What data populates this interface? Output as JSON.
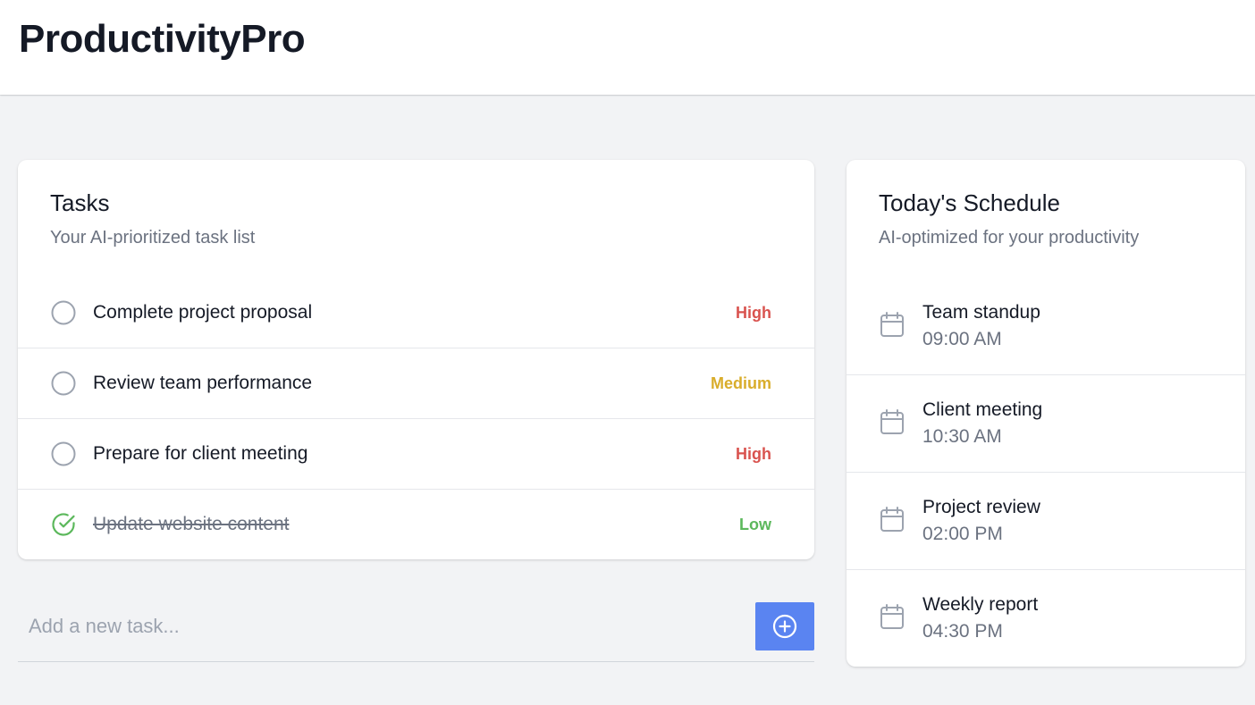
{
  "app": {
    "title": "ProductivityPro"
  },
  "tasks": {
    "title": "Tasks",
    "subtitle": "Your AI-prioritized task list",
    "items": [
      {
        "label": "Complete project proposal",
        "priority": "High",
        "priority_color": "#d9534f",
        "completed": false
      },
      {
        "label": "Review team performance",
        "priority": "Medium",
        "priority_color": "#d9ad2b",
        "completed": false
      },
      {
        "label": "Prepare for client meeting",
        "priority": "High",
        "priority_color": "#d9534f",
        "completed": false
      },
      {
        "label": "Update website content",
        "priority": "Low",
        "priority_color": "#5cb85c",
        "completed": true
      }
    ],
    "icons": {
      "open": "circle-icon",
      "done": "check-circle-icon"
    }
  },
  "add_task": {
    "placeholder": "Add a new task...",
    "button_icon": "plus-circle-icon",
    "button_color": "#5a84f1"
  },
  "schedule": {
    "title": "Today's Schedule",
    "subtitle": "AI-optimized for your productivity",
    "icon": "calendar-icon",
    "events": [
      {
        "title": "Team standup",
        "time": "09:00 AM"
      },
      {
        "title": "Client meeting",
        "time": "10:30 AM"
      },
      {
        "title": "Project review",
        "time": "02:00 PM"
      },
      {
        "title": "Weekly report",
        "time": "04:30 PM"
      }
    ]
  }
}
